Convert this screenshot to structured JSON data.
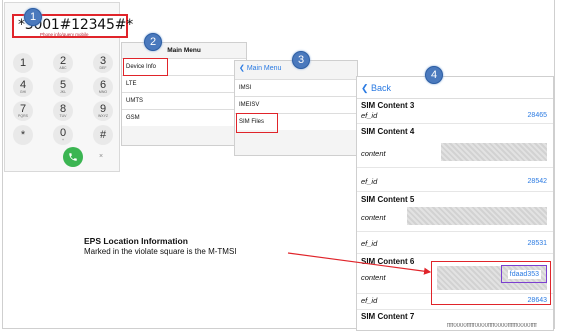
{
  "dialer": {
    "code": "*3001#12345#*",
    "subtitle": "Phone info/query mobile",
    "keys": [
      {
        "d": "1",
        "l": ""
      },
      {
        "d": "2",
        "l": "ABC"
      },
      {
        "d": "3",
        "l": "DEF"
      },
      {
        "d": "4",
        "l": "GHI"
      },
      {
        "d": "5",
        "l": "JKL"
      },
      {
        "d": "6",
        "l": "MNO"
      },
      {
        "d": "7",
        "l": "PQRS"
      },
      {
        "d": "8",
        "l": "TUV"
      },
      {
        "d": "9",
        "l": "WXYZ"
      },
      {
        "d": "*",
        "l": ""
      },
      {
        "d": "0",
        "l": "+"
      },
      {
        "d": "#",
        "l": ""
      }
    ],
    "delete_label": "×"
  },
  "steps": [
    "1",
    "2",
    "3",
    "4"
  ],
  "main_menu": {
    "title": "Main Menu",
    "items": [
      "Device Info",
      "LTE",
      "UMTS",
      "GSM"
    ]
  },
  "sub_menu": {
    "back": "Main Menu",
    "items": [
      "IMSI",
      "IMEISV",
      "SIM Files"
    ]
  },
  "sim_content": {
    "back": "Back",
    "sections": [
      {
        "title": "SIM Content 3",
        "key": "ef_id",
        "value": "28465"
      },
      {
        "title": "SIM Content 4",
        "content_key": "content",
        "key": "ef_id",
        "value": "28542"
      },
      {
        "title": "SIM Content 5",
        "content_key": "content",
        "key": "ef_id",
        "value": "28531"
      },
      {
        "title": "SIM Content 6",
        "content_key": "content",
        "content_value": "fdaad353",
        "key": "ef_id",
        "value": "28643"
      },
      {
        "title": "SIM Content 7"
      }
    ],
    "tail_text": "ffff0000fffff0000ffff0000ffffff0000ffff"
  },
  "annotation": {
    "title": "EPS Location Information",
    "text": "Marked in the violate square is the M-TMSI"
  },
  "colors": {
    "highlight": "#e0242a",
    "violet": "#7b3fd0",
    "link": "#2a7ae2",
    "badge": "#4a79bd"
  }
}
